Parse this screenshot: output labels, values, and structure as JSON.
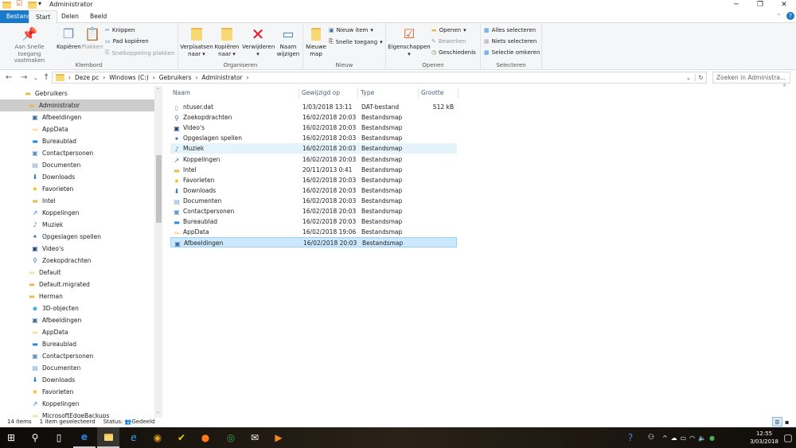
{
  "window": {
    "title": "Administrator",
    "minimize": "─",
    "restore": "❐",
    "close": "✕"
  },
  "tabs": [
    {
      "label": "Bestand"
    },
    {
      "label": "Start"
    },
    {
      "label": "Delen"
    },
    {
      "label": "Beeld"
    }
  ],
  "ribbon": {
    "klembord": {
      "label": "Klembord",
      "pin": "Aan Snelle toegang vastmaken",
      "copy": "Kopiëren",
      "paste": "Plakken",
      "cut": "Knippen",
      "copy_path": "Pad kopiëren",
      "paste_shortcut": "Snelkoppeling plakken"
    },
    "organiseren": {
      "label": "Organiseren",
      "move": "Verplaatsen naar",
      "copy_to": "Kopiëren naar",
      "delete": "Verwijderen",
      "rename": "Naam wijzigen"
    },
    "nieuw": {
      "label": "Nieuw",
      "new_folder": "Nieuwe map",
      "new_item": "Nieuw item",
      "easy_access": "Snelle toegang"
    },
    "openen": {
      "label": "Openen",
      "properties": "Eigenschappen",
      "open": "Openen",
      "edit": "Bewerken",
      "history": "Geschiedenis"
    },
    "selecteren": {
      "label": "Selecteren",
      "all": "Alles selecteren",
      "none": "Niets selecteren",
      "invert": "Selectie omkeren"
    }
  },
  "address": {
    "crumbs": [
      "Deze pc",
      "Windows (C:)",
      "Gebruikers",
      "Administrator"
    ],
    "search_placeholder": "Zoeken in Administra..."
  },
  "sidebar": [
    {
      "label": "Gebruikers",
      "level": 1,
      "icon": "folder"
    },
    {
      "label": "Administrator",
      "level": 2,
      "icon": "folder",
      "selected": true
    },
    {
      "label": "Afbeeldingen",
      "level": 3,
      "icon": "pictures"
    },
    {
      "label": "AppData",
      "level": 3,
      "icon": "folder-light"
    },
    {
      "label": "Bureaublad",
      "level": 3,
      "icon": "desktop"
    },
    {
      "label": "Contactpersonen",
      "level": 3,
      "icon": "contacts"
    },
    {
      "label": "Documenten",
      "level": 3,
      "icon": "documents"
    },
    {
      "label": "Downloads",
      "level": 3,
      "icon": "downloads"
    },
    {
      "label": "Favorieten",
      "level": 3,
      "icon": "star"
    },
    {
      "label": "Intel",
      "level": 3,
      "icon": "folder"
    },
    {
      "label": "Koppelingen",
      "level": 3,
      "icon": "links"
    },
    {
      "label": "Muziek",
      "level": 3,
      "icon": "music"
    },
    {
      "label": "Opgeslagen spellen",
      "level": 3,
      "icon": "games"
    },
    {
      "label": "Video's",
      "level": 3,
      "icon": "videos"
    },
    {
      "label": "Zoekopdrachten",
      "level": 3,
      "icon": "search"
    },
    {
      "label": "Default",
      "level": 2,
      "icon": "folder-light"
    },
    {
      "label": "Default.migrated",
      "level": 2,
      "icon": "folder"
    },
    {
      "label": "Herman",
      "level": 2,
      "icon": "folder"
    },
    {
      "label": "3D-objecten",
      "level": 3,
      "icon": "3d"
    },
    {
      "label": "Afbeeldingen",
      "level": 3,
      "icon": "pictures"
    },
    {
      "label": "AppData",
      "level": 3,
      "icon": "folder-light"
    },
    {
      "label": "Bureaublad",
      "level": 3,
      "icon": "desktop"
    },
    {
      "label": "Contactpersonen",
      "level": 3,
      "icon": "contacts"
    },
    {
      "label": "Documenten",
      "level": 3,
      "icon": "documents"
    },
    {
      "label": "Downloads",
      "level": 3,
      "icon": "downloads"
    },
    {
      "label": "Favorieten",
      "level": 3,
      "icon": "star"
    },
    {
      "label": "Koppelingen",
      "level": 3,
      "icon": "links"
    },
    {
      "label": "MicrosoftEdgeBackups",
      "level": 3,
      "icon": "folder-light"
    }
  ],
  "columns": {
    "name": "Naam",
    "modified": "Gewijzigd op",
    "type": "Type",
    "size": "Grootte"
  },
  "files": [
    {
      "name": "ntuser.dat",
      "modified": "1/03/2018 13:11",
      "type": "DAT-bestand",
      "size": "512 kB",
      "icon": "file"
    },
    {
      "name": "Zoekopdrachten",
      "modified": "16/02/2018 20:03",
      "type": "Bestandsmap",
      "size": "",
      "icon": "search"
    },
    {
      "name": "Video's",
      "modified": "16/02/2018 20:03",
      "type": "Bestandsmap",
      "size": "",
      "icon": "videos"
    },
    {
      "name": "Opgeslagen spellen",
      "modified": "16/02/2018 20:03",
      "type": "Bestandsmap",
      "size": "",
      "icon": "games"
    },
    {
      "name": "Muziek",
      "modified": "16/02/2018 20:03",
      "type": "Bestandsmap",
      "size": "",
      "icon": "music",
      "hover": true
    },
    {
      "name": "Koppelingen",
      "modified": "16/02/2018 20:03",
      "type": "Bestandsmap",
      "size": "",
      "icon": "links"
    },
    {
      "name": "Intel",
      "modified": "20/11/2013 0:41",
      "type": "Bestandsmap",
      "size": "",
      "icon": "folder"
    },
    {
      "name": "Favorieten",
      "modified": "16/02/2018 20:03",
      "type": "Bestandsmap",
      "size": "",
      "icon": "star"
    },
    {
      "name": "Downloads",
      "modified": "16/02/2018 20:03",
      "type": "Bestandsmap",
      "size": "",
      "icon": "downloads"
    },
    {
      "name": "Documenten",
      "modified": "16/02/2018 20:03",
      "type": "Bestandsmap",
      "size": "",
      "icon": "documents"
    },
    {
      "name": "Contactpersonen",
      "modified": "16/02/2018 20:03",
      "type": "Bestandsmap",
      "size": "",
      "icon": "contacts"
    },
    {
      "name": "Bureaublad",
      "modified": "16/02/2018 20:03",
      "type": "Bestandsmap",
      "size": "",
      "icon": "desktop"
    },
    {
      "name": "AppData",
      "modified": "16/02/2018 19:06",
      "type": "Bestandsmap",
      "size": "",
      "icon": "folder-light"
    },
    {
      "name": "Afbeeldingen",
      "modified": "16/02/2018 20:03",
      "type": "Bestandsmap",
      "size": "",
      "icon": "pictures",
      "selected": true
    }
  ],
  "status": {
    "count": "14 items",
    "selected": "1 item geselecteerd",
    "state_label": "Status:",
    "state": "Gedeeld"
  },
  "taskbar": {
    "time": "12:55",
    "date": "3/03/2018"
  },
  "colors": {
    "accent": "#1979ca",
    "selection": "#cce8ff",
    "hover": "#e5f3fb"
  }
}
